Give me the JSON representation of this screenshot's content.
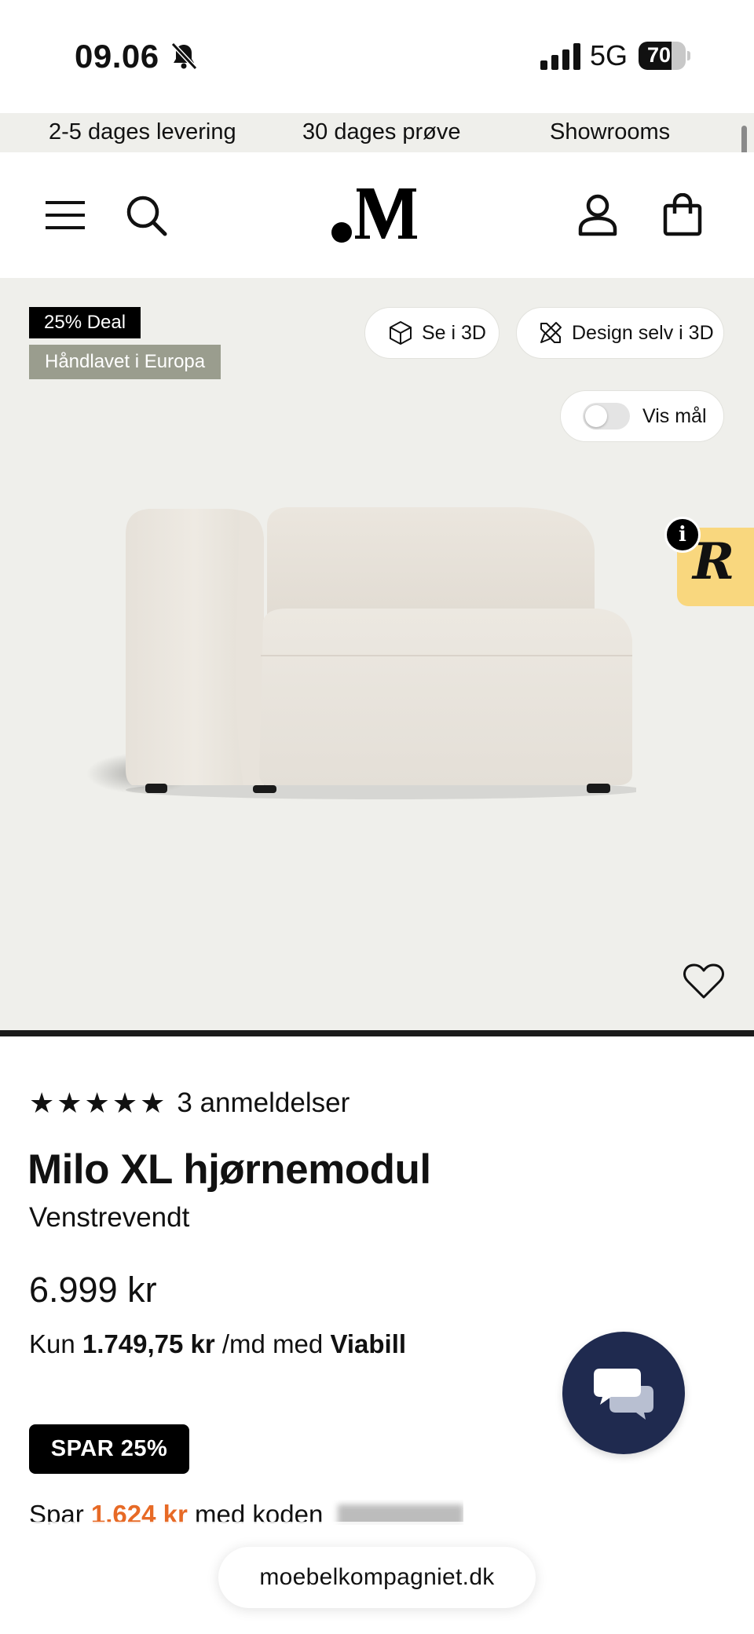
{
  "status_bar": {
    "time": "09.06",
    "network": "5G",
    "battery_percent": "70",
    "battery_level": 0.7,
    "icons": [
      "bell-muted-icon",
      "signal-icon",
      "battery-icon"
    ]
  },
  "usp_bar": {
    "items": [
      "2-5 dages levering",
      "30 dages prøve",
      "Showrooms"
    ]
  },
  "header": {
    "icons": [
      "menu-icon",
      "search-icon",
      "logo",
      "user-icon",
      "bag-icon"
    ]
  },
  "gallery": {
    "badges": {
      "deal": "25% Deal",
      "handmade": "Håndlavet i Europa"
    },
    "buttons": {
      "see_3d": "Se i 3D",
      "design_3d": "Design selv i 3D",
      "show_dimensions": "Vis mål"
    },
    "show_dimensions_on": false,
    "review_widget_letter": "R",
    "info_letter": "i"
  },
  "product": {
    "stars": "★★★★★",
    "rating": 5,
    "review_count": "3 anmeldelser",
    "title": "Milo XL hjørnemodul",
    "variant": "Venstrevendt",
    "price": "6.999 kr",
    "installment": {
      "prefix": "Kun",
      "amount": "1.749,75 kr",
      "middle": "/md med",
      "provider": "Viabill"
    },
    "save_badge": "SPAR 25%",
    "savings": {
      "prefix": "Spar",
      "amount": "1.624 kr",
      "suffix": "med koden"
    }
  },
  "url_bar": {
    "domain": "moebelkompagniet.dk"
  },
  "colors": {
    "gallery_bg": "#efefeb",
    "accent_orange": "#e76a26",
    "chat_blue": "#1f2a4f",
    "review_yellow": "#f9d77e",
    "handmade_badge": "#9a9d8e"
  }
}
